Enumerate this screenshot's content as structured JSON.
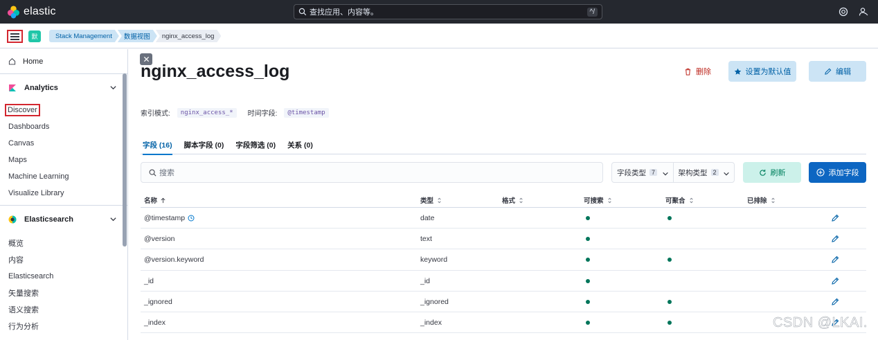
{
  "app": {
    "brand": "elastic"
  },
  "search": {
    "placeholder": "查找应用、内容等。",
    "shortcut": "^/"
  },
  "space": {
    "initial": "默"
  },
  "breadcrumbs": [
    "Stack Management",
    "数据视图",
    "nginx_access_log"
  ],
  "sidebar": {
    "home": "Home",
    "analytics": {
      "title": "Analytics",
      "items": [
        "Discover",
        "Dashboards",
        "Canvas",
        "Maps",
        "Machine Learning",
        "Visualize Library"
      ]
    },
    "elasticsearch": {
      "title": "Elasticsearch",
      "items": [
        "概览",
        "内容",
        "Elasticsearch",
        "矢量搜索",
        "语义搜索",
        "行为分析"
      ]
    }
  },
  "page": {
    "title": "nginx_access_log",
    "delete_label": "删除",
    "set_default_label": "设置为默认值",
    "edit_label": "编辑",
    "index_pattern_label": "索引模式:",
    "index_pattern_value": "nginx_access_*",
    "time_field_label": "时间字段:",
    "time_field_value": "@timestamp"
  },
  "tabs": [
    {
      "label": "字段 (16)",
      "active": true
    },
    {
      "label": "脚本字段 (0)",
      "active": false
    },
    {
      "label": "字段筛选 (0)",
      "active": false
    },
    {
      "label": "关系 (0)",
      "active": false
    }
  ],
  "toolbar": {
    "search_placeholder": "搜索",
    "filter_field_type": {
      "label": "字段类型",
      "count": "7"
    },
    "filter_schema_type": {
      "label": "架构类型",
      "count": "2"
    },
    "refresh_label": "刷新",
    "add_field_label": "添加字段"
  },
  "table": {
    "columns": [
      "名称",
      "类型",
      "格式",
      "可搜索",
      "可聚合",
      "已排除"
    ],
    "rows": [
      {
        "name": "@timestamp",
        "type": "date",
        "searchable": true,
        "aggregatable": true,
        "time_icon": true
      },
      {
        "name": "@version",
        "type": "text",
        "searchable": true,
        "aggregatable": false
      },
      {
        "name": "@version.keyword",
        "type": "keyword",
        "searchable": true,
        "aggregatable": true
      },
      {
        "name": "_id",
        "type": "_id",
        "searchable": true,
        "aggregatable": false
      },
      {
        "name": "_ignored",
        "type": "_ignored",
        "searchable": true,
        "aggregatable": true
      },
      {
        "name": "_index",
        "type": "_index",
        "searchable": true,
        "aggregatable": true
      }
    ]
  },
  "watermark": "CSDN @LKAI.",
  "colors": {
    "accent": "#0077cc",
    "dot": "#00755a",
    "danger": "#bd271e",
    "topbar": "#25282f"
  }
}
